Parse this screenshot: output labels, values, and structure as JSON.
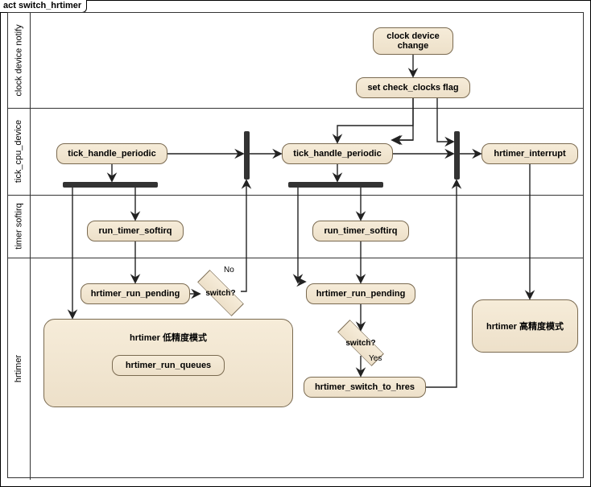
{
  "frame": {
    "title": "act switch_hrtimer"
  },
  "lanes": {
    "l1": "clock device notify",
    "l2": "tick_cpu_device",
    "l3": "timer softirq",
    "l4": "hrtimer"
  },
  "nodes": {
    "clock_device_change": "clock device\nchange",
    "set_check_clocks": "set check_clocks flag",
    "tick_handle_periodic_1": "tick_handle_periodic",
    "tick_handle_periodic_2": "tick_handle_periodic",
    "hrtimer_interrupt": "hrtimer_interrupt",
    "run_timer_softirq_1": "run_timer_softirq",
    "run_timer_softirq_2": "run_timer_softirq",
    "hrtimer_run_pending_1": "hrtimer_run_pending",
    "hrtimer_run_pending_2": "hrtimer_run_pending",
    "hrtimer_switch_to_hres": "hrtimer_switch_to_hres",
    "low_mode_title": "hrtimer 低精度模式",
    "hrtimer_run_queues": "hrtimer_run_queues",
    "high_mode_title": "hrtimer 高精度模式"
  },
  "decisions": {
    "switch1": "switch?",
    "switch2": "switch?"
  },
  "edge_labels": {
    "no": "No",
    "yes": "Yes"
  }
}
